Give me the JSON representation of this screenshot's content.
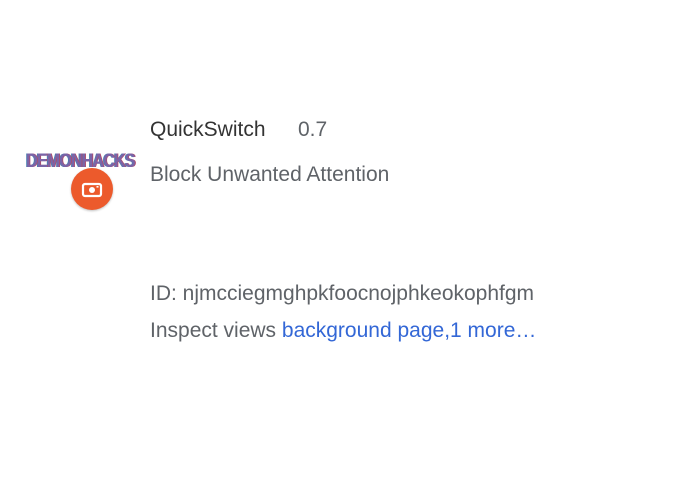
{
  "extension": {
    "icon": {
      "logo_text": "DEMONHACKS",
      "badge_icon": "camera-icon",
      "badge_color": "#ec5a2c"
    },
    "name": "QuickSwitch",
    "version": "0.7",
    "description": "Block Unwanted Attention",
    "id_label": "ID: njmcciegmghpkfoocnojphkeokophfgm",
    "inspect": {
      "label": "Inspect views",
      "background_link": "background page,",
      "more_link": "1 more…"
    }
  },
  "colors": {
    "text_primary": "#333333",
    "text_secondary": "#5f6368",
    "link": "#3367d6",
    "badge": "#ec5a2c"
  }
}
